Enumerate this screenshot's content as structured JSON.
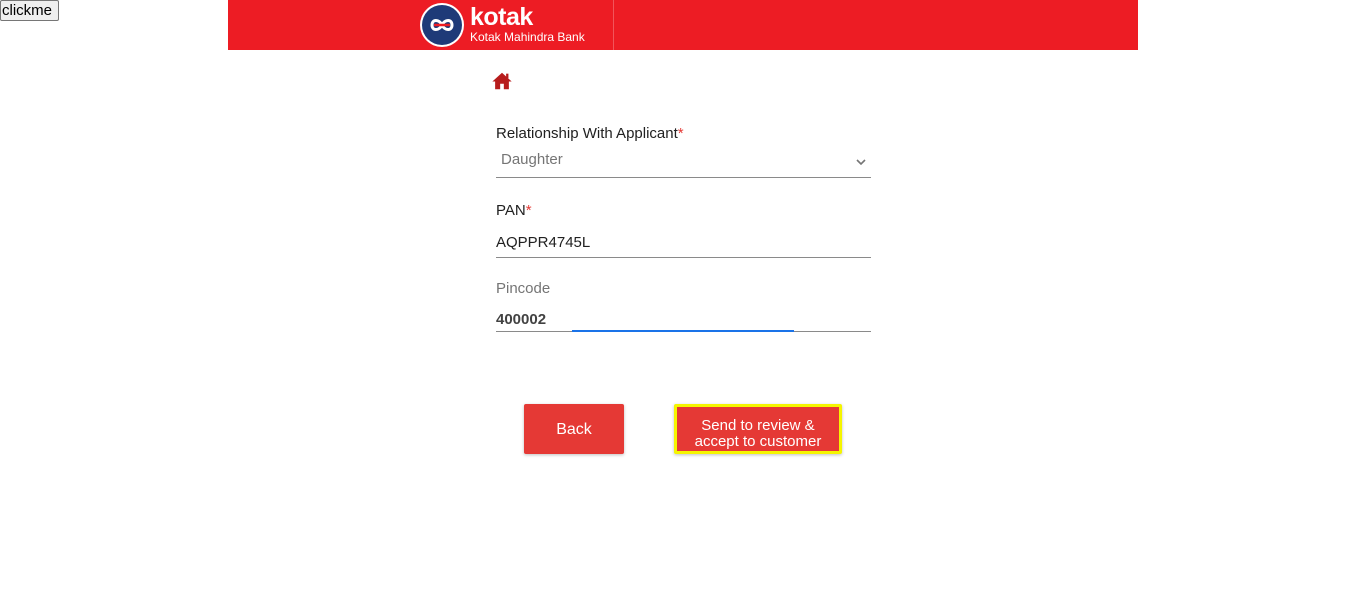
{
  "debug_button": {
    "label": "clickme"
  },
  "header": {
    "brand": "kotak",
    "subtitle": "Kotak Mahindra Bank",
    "background_color": "#ed1c24"
  },
  "home": {
    "icon": "home-icon",
    "color": "#b71c1c"
  },
  "form": {
    "relationship": {
      "label": "Relationship With Applicant",
      "required_mark": "*",
      "value": "Daughter"
    },
    "pan": {
      "label": "PAN",
      "required_mark": "*",
      "value": "AQPPR4745L"
    },
    "pincode": {
      "label": "Pincode",
      "value": "400002"
    }
  },
  "actions": {
    "back_label": "Back",
    "send_label": "Send to review & accept to customer",
    "button_color": "#e53935",
    "highlight_color": "#f5f500"
  }
}
